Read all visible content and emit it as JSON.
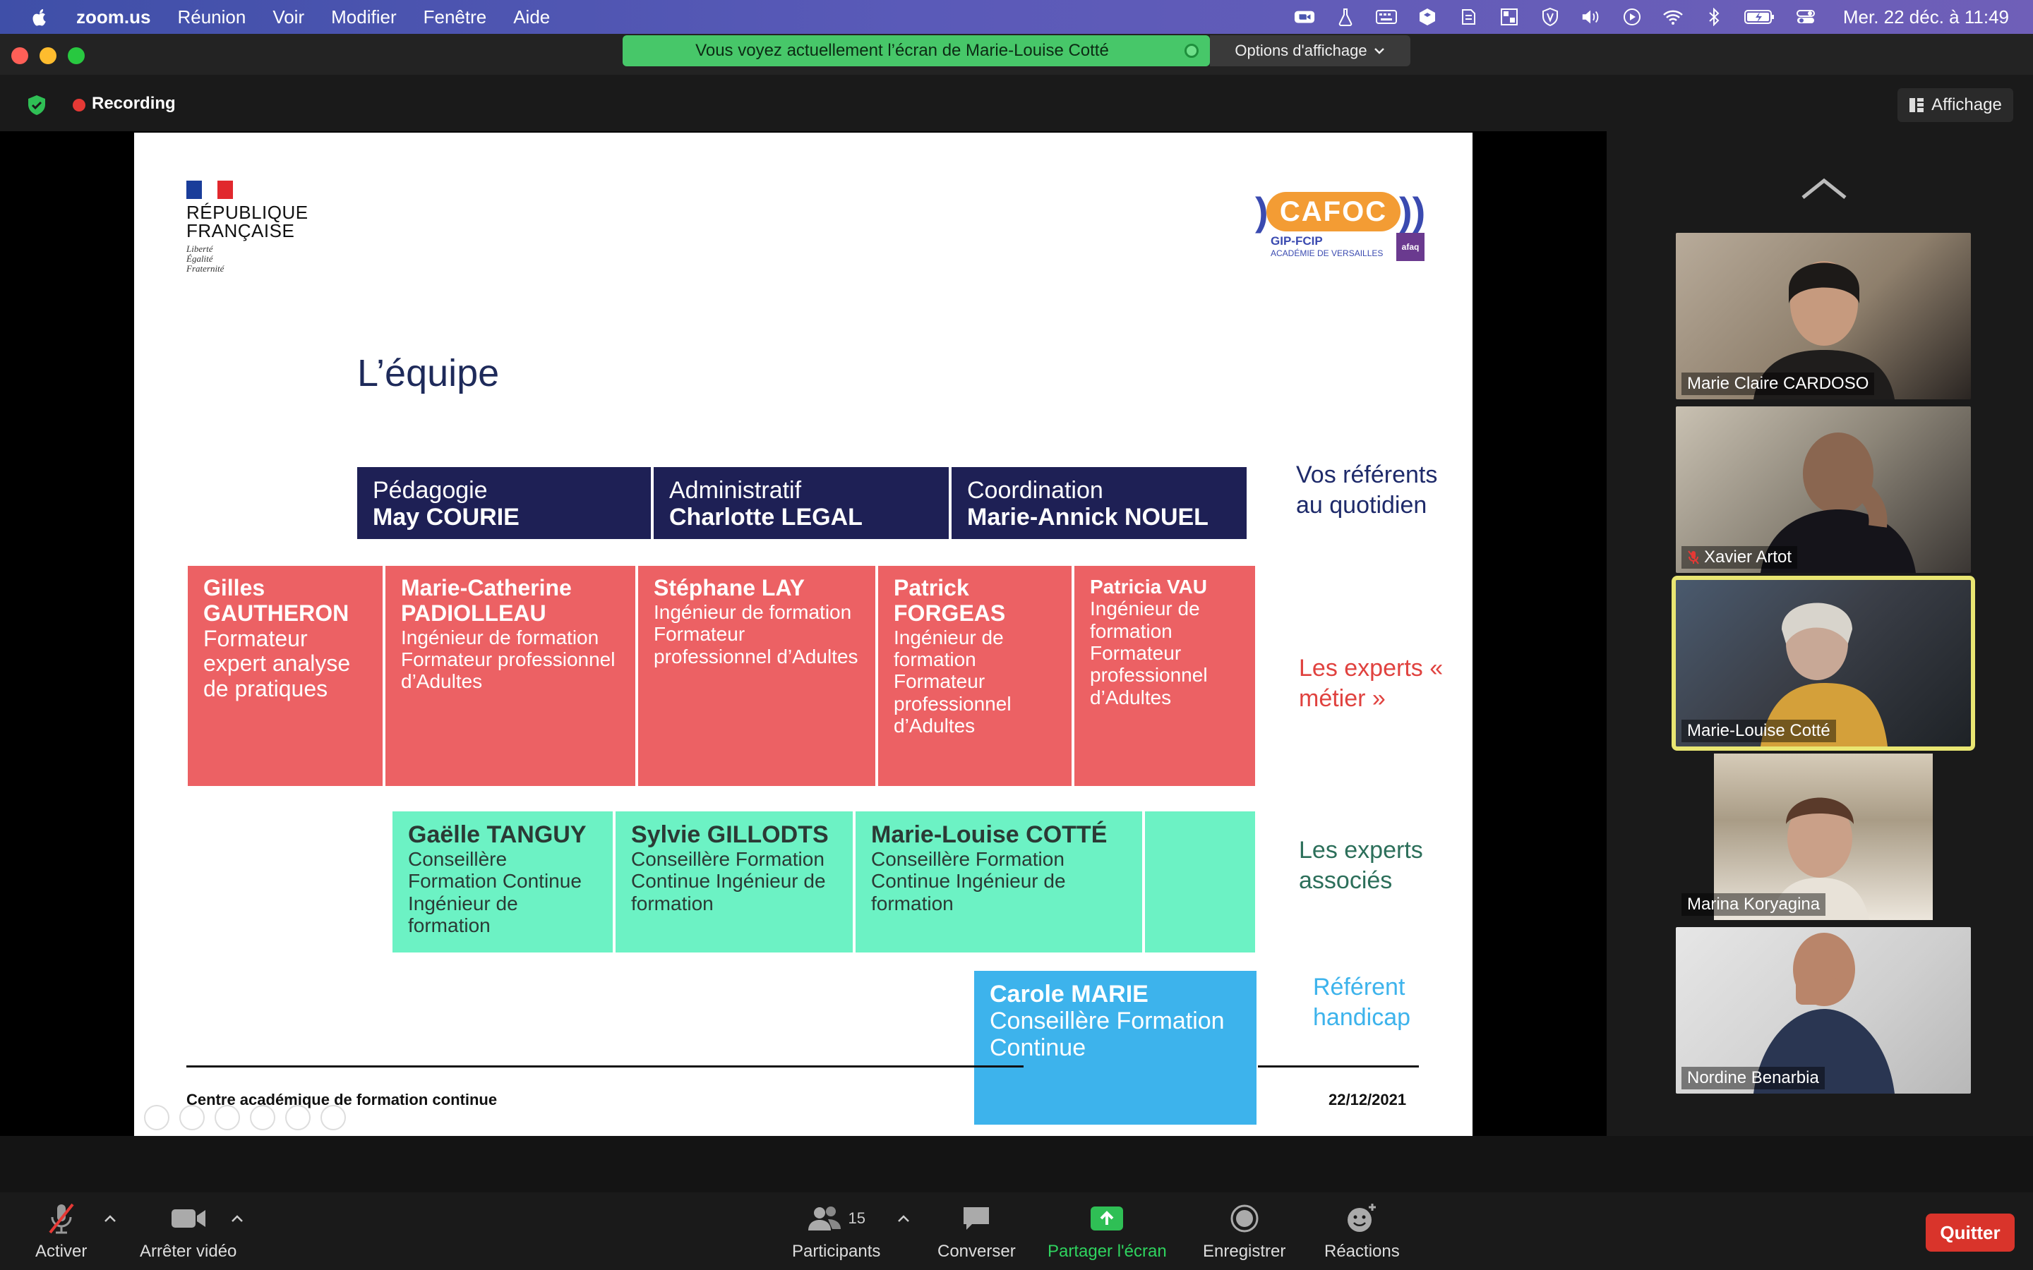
{
  "menubar": {
    "app_name": "zoom.us",
    "items": [
      "Réunion",
      "Voir",
      "Modifier",
      "Fenêtre",
      "Aide"
    ],
    "clock": "Mer. 22 déc. à  11:49"
  },
  "share_banner": {
    "message": "Vous voyez actuellement l’écran de Marie-Louise Cotté",
    "options_label": "Options d'affichage"
  },
  "meeting": {
    "recording_label": "Recording",
    "view_label": "Affichage"
  },
  "slide": {
    "rf_lines": [
      "RÉPUBLIQUE",
      "FRANÇAISE"
    ],
    "rf_motto": [
      "Liberté",
      "Égalité",
      "Fraternité"
    ],
    "cafoc_name": "CAFOC",
    "cafoc_sub1": "GIP-FCIP",
    "cafoc_sub2": "ACADÉMIE DE VERSAILLES",
    "cafoc_badge": "afaq",
    "title": "L’équipe",
    "navy": [
      {
        "role": "Pédagogie",
        "name": "May COURIE"
      },
      {
        "role": "Administratif",
        "name": "Charlotte LEGAL"
      },
      {
        "role": "Coordination",
        "name": "Marie-Annick NOUEL"
      }
    ],
    "navy_label": "Vos référents au quotidien",
    "red": [
      {
        "name": "Gilles GAUTHERON",
        "role": "Formateur expert analyse de pratiques"
      },
      {
        "name": "Marie-Catherine PADIOLLEAU",
        "role": "Ingénieur de formation Formateur professionnel d’Adultes"
      },
      {
        "name": "Stéphane LAY",
        "role": "Ingénieur de formation Formateur professionnel d’Adultes"
      },
      {
        "name": "Patrick FORGEAS",
        "role": "Ingénieur de formation Formateur professionnel d’Adultes"
      },
      {
        "name": "Patricia VAU",
        "role": "Ingénieur de formation Formateur professionnel d’Adultes"
      }
    ],
    "red_label": "Les experts « métier »",
    "green": [
      {
        "name": "Gaëlle TANGUY",
        "role": "Conseillère Formation Continue Ingénieur de formation"
      },
      {
        "name": "Sylvie GILLODTS",
        "role": "Conseillère Formation Continue Ingénieur de formation"
      },
      {
        "name": "Marie-Louise COTTÉ",
        "role": "Conseillère Formation Continue Ingénieur de formation"
      }
    ],
    "green_label": "Les experts associés",
    "blue": {
      "name": "Carole MARIE",
      "role": "Conseillère Formation Continue"
    },
    "blue_label": "Référent handicap",
    "footer_left": "Centre académique de formation continue",
    "footer_right": "22/12/2021"
  },
  "participants_tiles": [
    {
      "name": "Marie Claire CARDOSO",
      "muted": false,
      "active": false
    },
    {
      "name": "Xavier Artot",
      "muted": true,
      "active": false
    },
    {
      "name": "Marie-Louise Cotté",
      "muted": false,
      "active": true
    },
    {
      "name": "Marina Koryagina",
      "muted": false,
      "active": false
    },
    {
      "name": "Nordine Benarbia",
      "muted": false,
      "active": false
    }
  ],
  "toolbar": {
    "mute_label": "Activer",
    "video_label": "Arrêter vidéo",
    "participants_label": "Participants",
    "participants_count": "15",
    "chat_label": "Converser",
    "share_label": "Partager l'écran",
    "record_label": "Enregistrer",
    "reactions_label": "Réactions",
    "quit_label": "Quitter"
  },
  "colors": {
    "navy": "#1e2055",
    "red": "#ec6164",
    "green": "#6cf2c4",
    "blue": "#3db3ec",
    "share_green": "#47c769",
    "quit_red": "#d9342b"
  }
}
